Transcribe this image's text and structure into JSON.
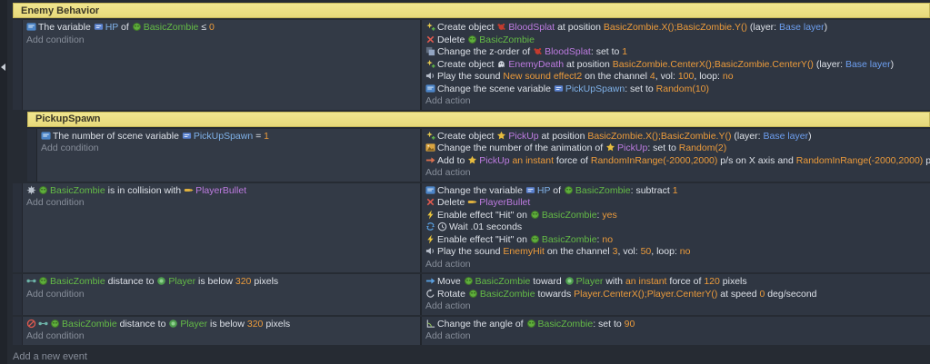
{
  "labels": {
    "add_condition": "Add condition",
    "add_action": "Add action",
    "add_event": "Add a new event"
  },
  "colors": {
    "page_bg": "#262b33",
    "gutter_bg": "#20242b",
    "cond_bg": "#333a46",
    "act_bg": "#2f3642",
    "handle_bg": "#2a303b",
    "divider": "#21252c",
    "text": "#dde1e8",
    "muted": "#878e9a",
    "object_green": "#64bb46",
    "object_purple": "#bd7be0",
    "variable_blue": "#7fb1e8",
    "value_orange": "#ec9b3b",
    "layer_blue": "#6d9ff0",
    "group_bg": "#f1e68f",
    "group_bg2": "#e7d97a",
    "group_border": "#c6b85c",
    "group_text": "#3b3826"
  },
  "events": [
    {
      "type": "group",
      "level": 0,
      "label": "Enemy Behavior"
    },
    {
      "type": "event",
      "level": 0,
      "conditions": [
        [
          {
            "i": "variable-icon"
          },
          {
            "s": "The variable "
          },
          {
            "i": "var-chip-icon"
          },
          {
            "s": "HP",
            "c": "varb"
          },
          {
            "s": " of "
          },
          {
            "i": "zombie-thumb"
          },
          {
            "s": "BasicZombie",
            "c": "green"
          },
          {
            "s": " ≤ "
          },
          {
            "s": "0",
            "c": "num"
          }
        ]
      ],
      "actions": [
        [
          {
            "i": "create-icon"
          },
          {
            "s": "Create object "
          },
          {
            "i": "bloodsplat-thumb"
          },
          {
            "s": "BloodSplat",
            "c": "purple"
          },
          {
            "s": " at position "
          },
          {
            "s": "BasicZombie.X();BasicZombie.Y()",
            "c": "num"
          },
          {
            "s": " (layer: "
          },
          {
            "s": "Base layer",
            "c": "layer"
          },
          {
            "s": ")"
          }
        ],
        [
          {
            "i": "delete-icon"
          },
          {
            "s": "Delete "
          },
          {
            "i": "zombie-thumb"
          },
          {
            "s": "BasicZombie",
            "c": "green"
          }
        ],
        [
          {
            "i": "zorder-icon"
          },
          {
            "s": "Change the z-order of "
          },
          {
            "i": "bloodsplat-thumb"
          },
          {
            "s": "BloodSplat",
            "c": "purple"
          },
          {
            "s": ": set to "
          },
          {
            "s": "1",
            "c": "num"
          }
        ],
        [
          {
            "i": "create-icon"
          },
          {
            "s": "Create object "
          },
          {
            "i": "enemydeath-thumb"
          },
          {
            "s": "EnemyDeath",
            "c": "purple"
          },
          {
            "s": " at position "
          },
          {
            "s": "BasicZombie.CenterX();BasicZombie.CenterY()",
            "c": "num"
          },
          {
            "s": " (layer: "
          },
          {
            "s": "Base layer",
            "c": "layer"
          },
          {
            "s": ")"
          }
        ],
        [
          {
            "i": "sound-icon"
          },
          {
            "s": "Play the sound "
          },
          {
            "s": "New sound effect2",
            "c": "num"
          },
          {
            "s": " on the channel "
          },
          {
            "s": "4",
            "c": "num"
          },
          {
            "s": ", vol: "
          },
          {
            "s": "100",
            "c": "num"
          },
          {
            "s": ", loop: "
          },
          {
            "s": "no",
            "c": "num"
          }
        ],
        [
          {
            "i": "variable-icon"
          },
          {
            "s": "Change the scene variable "
          },
          {
            "i": "var-chip-icon"
          },
          {
            "s": "PickUpSpawn",
            "c": "varb"
          },
          {
            "s": ": set to "
          },
          {
            "s": "Random(10)",
            "c": "num"
          }
        ]
      ]
    },
    {
      "type": "group",
      "level": 1,
      "label": "PickupSpawn"
    },
    {
      "type": "event",
      "level": 1,
      "conditions": [
        [
          {
            "i": "variable-icon"
          },
          {
            "s": "The number of scene variable "
          },
          {
            "i": "var-chip-icon"
          },
          {
            "s": "PickUpSpawn",
            "c": "varb"
          },
          {
            "s": " = "
          },
          {
            "s": "1",
            "c": "num"
          }
        ]
      ],
      "actions": [
        [
          {
            "i": "create-icon"
          },
          {
            "s": "Create object "
          },
          {
            "i": "pickup-thumb"
          },
          {
            "s": "PickUp",
            "c": "purple"
          },
          {
            "s": " at position "
          },
          {
            "s": "BasicZombie.X();BasicZombie.Y()",
            "c": "num"
          },
          {
            "s": " (layer: "
          },
          {
            "s": "Base layer",
            "c": "layer"
          },
          {
            "s": ")"
          }
        ],
        [
          {
            "i": "animation-icon"
          },
          {
            "s": "Change the number of the animation of "
          },
          {
            "i": "pickup-thumb"
          },
          {
            "s": "PickUp",
            "c": "purple"
          },
          {
            "s": ": set to "
          },
          {
            "s": "Random(2)",
            "c": "num"
          }
        ],
        [
          {
            "i": "force-icon"
          },
          {
            "s": "Add to "
          },
          {
            "i": "pickup-thumb"
          },
          {
            "s": "PickUp",
            "c": "purple"
          },
          {
            "s": " "
          },
          {
            "s": "an instant",
            "c": "num"
          },
          {
            "s": " force of "
          },
          {
            "s": "RandomInRange(-2000,2000)",
            "c": "num"
          },
          {
            "s": " p/s on X axis and "
          },
          {
            "s": "RandomInRange(-2000,2000)",
            "c": "num"
          },
          {
            "s": " p/s on Y axis"
          }
        ]
      ]
    },
    {
      "type": "event",
      "level": 0,
      "conditions": [
        [
          {
            "i": "collision-icon"
          },
          {
            "i": "zombie-thumb"
          },
          {
            "s": "BasicZombie",
            "c": "green"
          },
          {
            "s": " is in collision with "
          },
          {
            "i": "bullet-thumb"
          },
          {
            "s": "PlayerBullet",
            "c": "purple"
          }
        ]
      ],
      "actions": [
        [
          {
            "i": "variable-icon"
          },
          {
            "s": "Change the variable "
          },
          {
            "i": "var-chip-icon"
          },
          {
            "s": "HP",
            "c": "varb"
          },
          {
            "s": " of "
          },
          {
            "i": "zombie-thumb"
          },
          {
            "s": "BasicZombie",
            "c": "green"
          },
          {
            "s": ": subtract "
          },
          {
            "s": "1",
            "c": "num"
          }
        ],
        [
          {
            "i": "delete-icon"
          },
          {
            "s": "Delete "
          },
          {
            "i": "bullet-thumb"
          },
          {
            "s": "PlayerBullet",
            "c": "purple"
          }
        ],
        [
          {
            "i": "effect-icon"
          },
          {
            "s": "Enable effect "
          },
          {
            "s": "\"Hit\""
          },
          {
            "s": " on "
          },
          {
            "i": "zombie-thumb"
          },
          {
            "s": "BasicZombie",
            "c": "green"
          },
          {
            "s": ": "
          },
          {
            "s": "yes",
            "c": "num"
          }
        ],
        [
          {
            "i": "async-icon"
          },
          {
            "i": "wait-icon"
          },
          {
            "s": "Wait "
          },
          {
            "s": ".01"
          },
          {
            "s": " seconds"
          }
        ],
        [
          {
            "i": "effect-icon"
          },
          {
            "s": "Enable effect "
          },
          {
            "s": "\"Hit\""
          },
          {
            "s": " on "
          },
          {
            "i": "zombie-thumb"
          },
          {
            "s": "BasicZombie",
            "c": "green"
          },
          {
            "s": ": "
          },
          {
            "s": "no",
            "c": "num"
          }
        ],
        [
          {
            "i": "sound-icon"
          },
          {
            "s": "Play the sound "
          },
          {
            "s": "EnemyHit",
            "c": "num"
          },
          {
            "s": " on the channel "
          },
          {
            "s": "3",
            "c": "num"
          },
          {
            "s": ", vol: "
          },
          {
            "s": "50",
            "c": "num"
          },
          {
            "s": ", loop: "
          },
          {
            "s": "no",
            "c": "num"
          }
        ]
      ]
    },
    {
      "type": "event",
      "level": 0,
      "conditions": [
        [
          {
            "i": "distance-icon"
          },
          {
            "i": "zombie-thumb"
          },
          {
            "s": "BasicZombie",
            "c": "green"
          },
          {
            "s": " distance to "
          },
          {
            "i": "player-thumb"
          },
          {
            "s": "Player",
            "c": "green"
          },
          {
            "s": " is below "
          },
          {
            "s": "320",
            "c": "num"
          },
          {
            "s": " pixels"
          }
        ]
      ],
      "actions": [
        [
          {
            "i": "move-icon"
          },
          {
            "s": "Move "
          },
          {
            "i": "zombie-thumb"
          },
          {
            "s": "BasicZombie",
            "c": "green"
          },
          {
            "s": " toward "
          },
          {
            "i": "player-thumb"
          },
          {
            "s": "Player",
            "c": "green"
          },
          {
            "s": " with "
          },
          {
            "s": "an instant",
            "c": "num"
          },
          {
            "s": " force of "
          },
          {
            "s": "120",
            "c": "num"
          },
          {
            "s": " pixels"
          }
        ],
        [
          {
            "i": "rotate-icon"
          },
          {
            "s": "Rotate "
          },
          {
            "i": "zombie-thumb"
          },
          {
            "s": "BasicZombie",
            "c": "green"
          },
          {
            "s": " towards "
          },
          {
            "s": "Player.CenterX();Player.CenterY()",
            "c": "num"
          },
          {
            "s": " at speed "
          },
          {
            "s": "0",
            "c": "num"
          },
          {
            "s": " deg/second"
          }
        ]
      ]
    },
    {
      "type": "event",
      "level": 0,
      "conditions": [
        [
          {
            "i": "invert-icon"
          },
          {
            "i": "distance-icon"
          },
          {
            "i": "zombie-thumb"
          },
          {
            "s": "BasicZombie",
            "c": "green"
          },
          {
            "s": " distance to "
          },
          {
            "i": "player-thumb"
          },
          {
            "s": "Player",
            "c": "green"
          },
          {
            "s": " is below "
          },
          {
            "s": "320",
            "c": "num"
          },
          {
            "s": " pixels"
          }
        ]
      ],
      "actions": [
        [
          {
            "i": "angle-icon"
          },
          {
            "s": "Change the angle of "
          },
          {
            "i": "zombie-thumb"
          },
          {
            "s": "BasicZombie",
            "c": "green"
          },
          {
            "s": ": set to "
          },
          {
            "s": "90",
            "c": "num"
          }
        ]
      ]
    }
  ]
}
